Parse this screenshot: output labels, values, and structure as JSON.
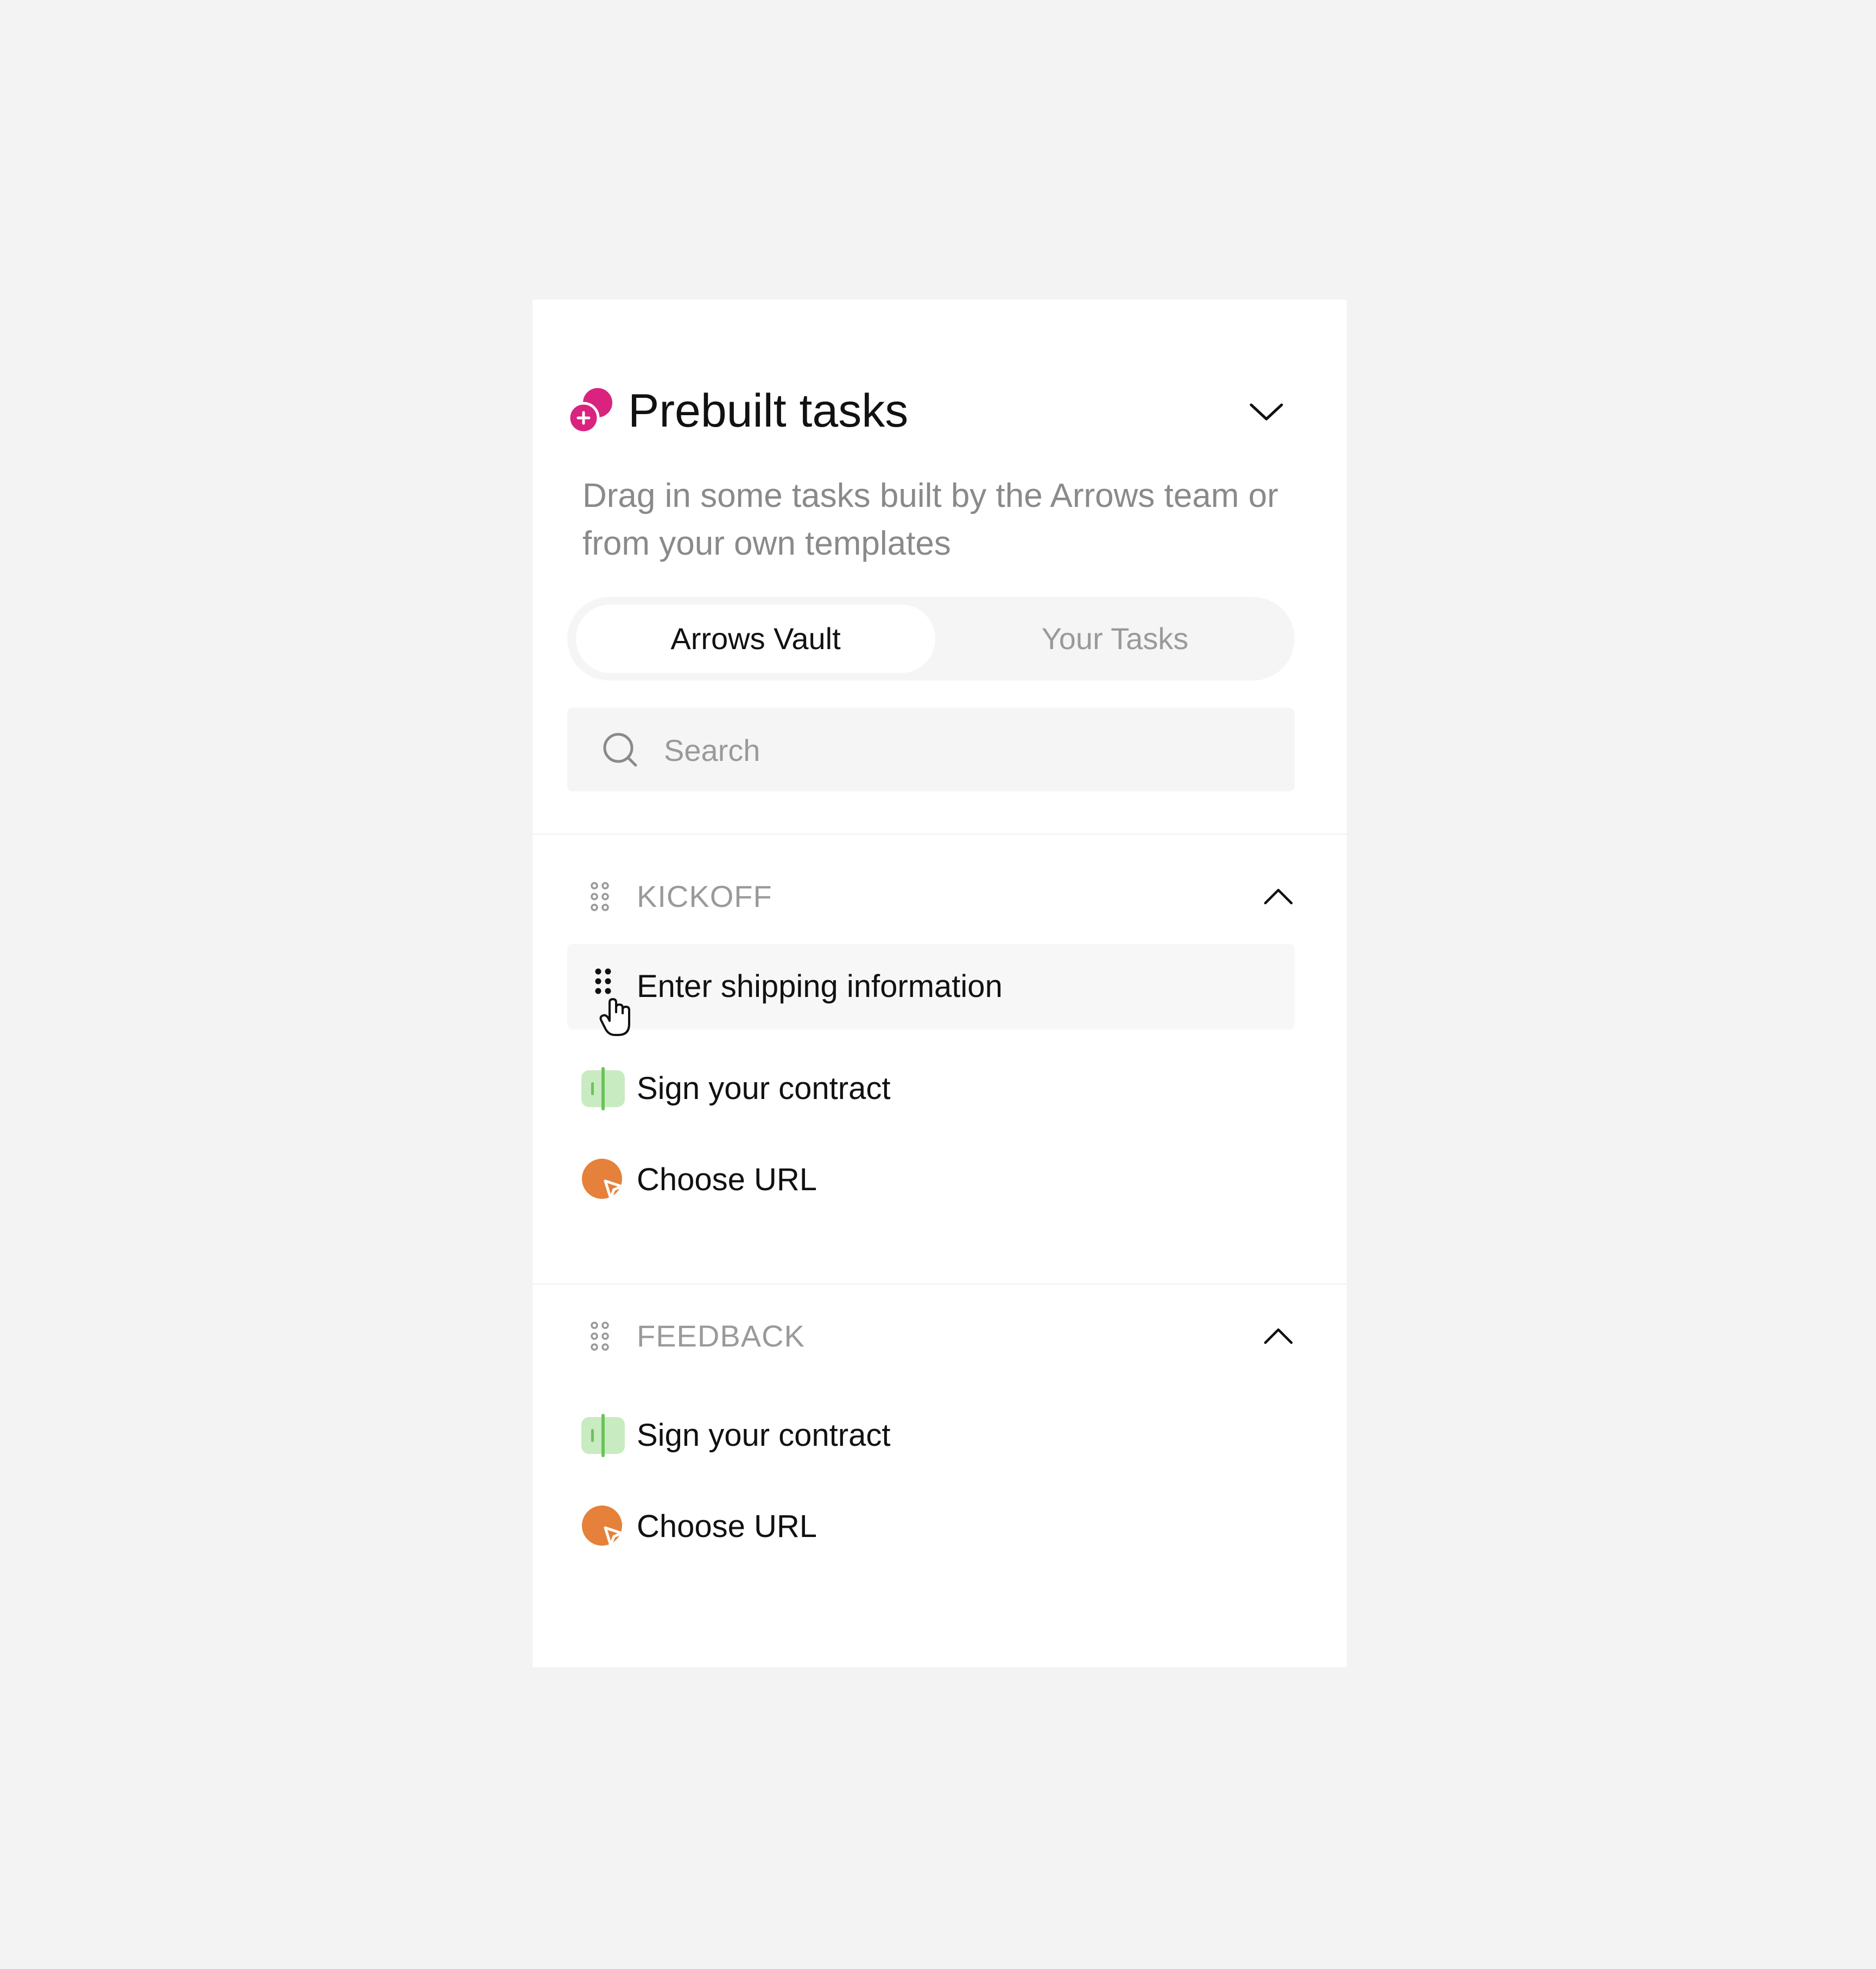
{
  "panel": {
    "title": "Prebuilt tasks",
    "description": "Drag in some tasks built by the Arrows team or from your own templates",
    "logo_icon": "pink-sparkle-logo-icon",
    "collapse_icon": "chevron-down-icon"
  },
  "tabs": [
    {
      "label": "Arrows Vault",
      "active": true
    },
    {
      "label": "Your Tasks",
      "active": false
    }
  ],
  "search": {
    "placeholder": "Search",
    "value": "",
    "icon": "search-icon"
  },
  "sections": [
    {
      "label": "KICKOFF",
      "expanded": true,
      "tasks": [
        {
          "label": "Enter shipping information",
          "icon": "drag-handle-icon",
          "hovered": true
        },
        {
          "label": "Sign your contract",
          "icon": "contract-icon"
        },
        {
          "label": "Choose URL",
          "icon": "choose-url-icon"
        }
      ]
    },
    {
      "label": "FEEDBACK",
      "expanded": true,
      "tasks": [
        {
          "label": "Sign your contract",
          "icon": "contract-icon"
        },
        {
          "label": "Choose URL",
          "icon": "choose-url-icon"
        }
      ]
    }
  ],
  "colors": {
    "background": "#f3f3f3",
    "panel": "#ffffff",
    "brand_pink": "#d9237f",
    "contract_green": "#6cc35a",
    "contract_green_light": "#c9ebc1",
    "url_orange": "#e5813a",
    "muted_text": "#9a9a9a"
  }
}
